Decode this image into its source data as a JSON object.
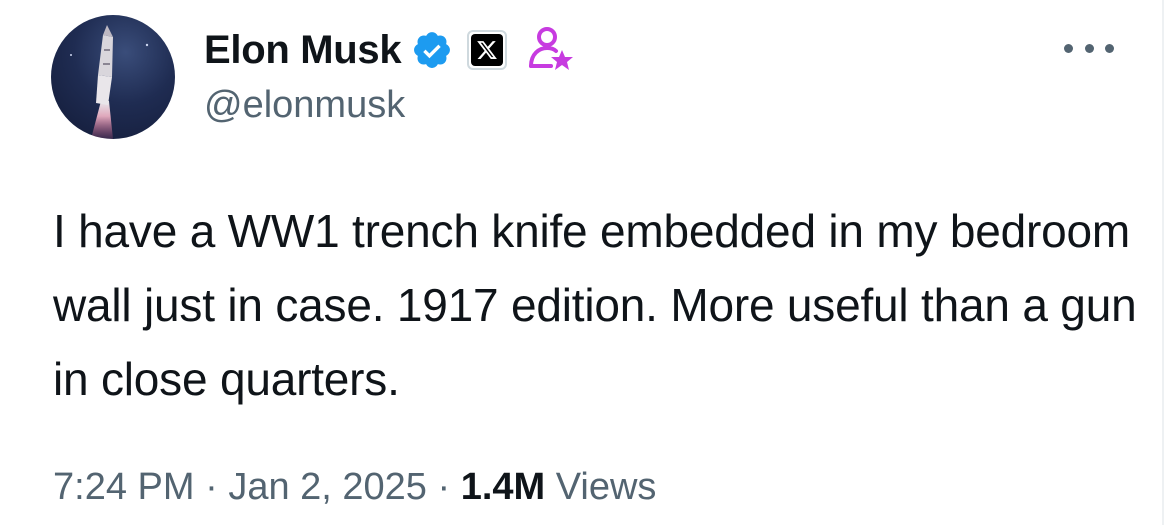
{
  "author": {
    "name": "Elon Musk",
    "handle": "@elonmusk",
    "avatar_icon": "rocket-launch-icon",
    "verified_icon": "verified-badge-icon",
    "verified_color": "#1d9bf0",
    "affiliate_icon": "x-logo-icon",
    "role_icon": "person-star-icon",
    "role_color": "#c73be0"
  },
  "tweet": {
    "text": "I have a WW1 trench knife embedded in my bedroom wall just in case. 1917 edition. More useful than a gun in close quarters.",
    "time": "7:24 PM",
    "separator": "·",
    "date": "Jan 2, 2025",
    "views_count": "1.4M",
    "views_label": "Views"
  },
  "actions": {
    "more_icon": "more-options-icon"
  }
}
